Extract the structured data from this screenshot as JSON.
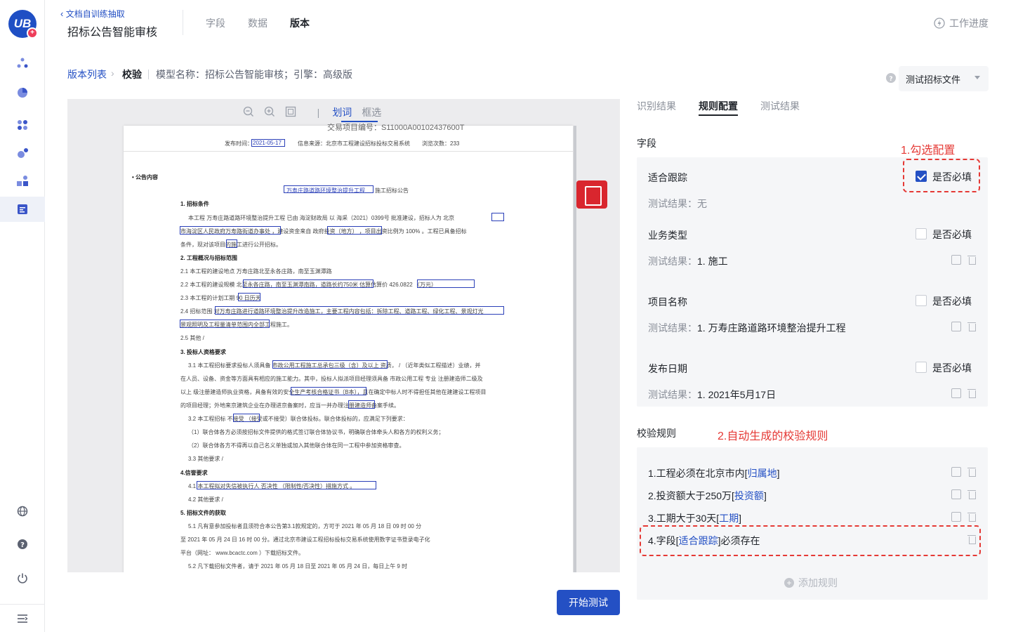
{
  "sidebar": {
    "logo": "UB",
    "logo_plus": "+"
  },
  "header": {
    "back_label": "文档自训练抽取",
    "app_title": "招标公告智能审核",
    "tabs": [
      {
        "label": "字段"
      },
      {
        "label": "数据"
      },
      {
        "label": "版本"
      }
    ],
    "progress_label": "工作进度"
  },
  "breadcrumb": {
    "version_list": "版本列表",
    "separator": "›",
    "current": "校验",
    "model_info": "模型名称：招标公告智能审核；引擎：高级版"
  },
  "file_select": {
    "value": "测试招标文件"
  },
  "viewer": {
    "tool_pipe": "|",
    "tool_word": "划词",
    "tool_box": "框选",
    "doc": {
      "top_cut": "交易项目编号：S11000A00102437600T",
      "meta_time": "发布时间：",
      "meta_date": "2021-05-17",
      "meta_source": "信息来源：北京市工程建设招标投标交易系统",
      "meta_views": "浏览次数：233",
      "section_label": "• 公告内容",
      "doc_title_name": "万寿庄路道路环境整治提升工程",
      "doc_title_suffix": "施工招标公告",
      "h1": "1. 招标条件",
      "p1a": "本工程    万寿庄路道路环境整治提升工程    已由    海淀财政局    以    海采（2021）0399号    批准建设，招标人为    北京",
      "p1b": "市海淀区人民政府万寿路街道办事处    ，建设资金来自    政府投资（地方）    ，项目出资比例为    100%    。工程已具备招标",
      "p1c": "条件，现对该项目的施工进行公开招标。",
      "h2": "2. 工程概况与招标范围",
      "p2a": "2.1  本工程的建设地点    万寿庄路北至永各庄路，南至玉渊潭路",
      "p2b": "2.2  本工程的建设规模    北至永各庄路，南至玉渊潭南路，道路长约750米     估算估算价    426.0822    （万元）",
      "p2c": "2.3  本工程的计划工期    90    日历天",
      "p2d": "2.4  招标范围    对万寿庄路进行道路环境整治提升改造施工，主要工程内容包括：拆除工程、道路工程、绿化工程、景观灯光",
      "p2e": "景观照明及工程量清单范围内全部工程施工。",
      "p2f": "2.5  其他    /",
      "h3": "3. 投标人资格要求",
      "p3a": "3.1 本工程招标要求投标人须具备    市政公用工程施工总承包三级（含）及以上    资质，    /    （近年类似工程描述）业绩，并",
      "p3b": "在人员、设备、资金等方面具有相应的施工能力。其中，投标人拟派项目经理须具备    市政公用工程    专业    注册建造师二级及",
      "p3c": "以上    级注册建造师执业资格，具备有效的安全生产考核合格证书（B本），且在确定中标人时不得担任其他在建建设工程项目",
      "p3d": "的项目经理；外地来京建筑企业在办理进京备案时，应当一并办理注册建造师备案手续。",
      "p3e": "3.2 本工程招标    不接受    （接受或不接受）联合体投标。联合体投标的，应满足下列要求：",
      "p3f": "（1）联合体各方必须按招标文件提供的格式签订联合体协议书，明确联合体牵头人和各方的权利义务；",
      "p3g": "（2）联合体各方不得再以自己名义单独或加入其他联合体在同一工程中参加资格审查。",
      "p3h": "3.3 其他要求    /",
      "h4": "4.信誉要求",
      "p4a": "4.1    本工程拟对失信被执行人    否决性    （限制性/否决性）措施方式    。",
      "p4b": "4.2 其他要求    /",
      "h5": "5. 招标文件的获取",
      "p5a": "5.1 凡有意参加投标者且须符合本公告第3.1款规定的，方可于    2021    年    05    月    18    日    09    时    00    分",
      "p5b": "至    2021    年    05    月    24    日    16    时    00    分。通过北京市建设工程招标投标交易系统使用数字证书登录电子化",
      "p5c": "平台（网址：    www.bcactc.com    ）下载招标文件。",
      "p5d": "5.2 凡下载招标文件者，请于    2021    年    05    月    18    日至    2021    年    05    月    24    日，每日上午    9    时"
    }
  },
  "start_button": "开始测试",
  "right_tabs": [
    {
      "label": "识别结果"
    },
    {
      "label": "规则配置"
    },
    {
      "label": "测试结果"
    }
  ],
  "fields_section": {
    "title": "字段",
    "annotation": "1.勾选配置",
    "test_prefix": "测试结果：",
    "required_label": "是否必填",
    "items": [
      {
        "name": "适合跟踪",
        "result": "无",
        "required": true
      },
      {
        "name": "业务类型",
        "result": "1. 施工",
        "required": false
      },
      {
        "name": "项目名称",
        "result": "1. 万寿庄路道路环境整治提升工程",
        "required": false
      },
      {
        "name": "发布日期",
        "result": "1. 2021年5月17日",
        "required": false
      }
    ]
  },
  "rules_section": {
    "title": "校验规则",
    "annotation": "2.自动生成的校验规则",
    "rules": [
      {
        "prefix": "1.工程必须在北京市内[",
        "field": "归属地",
        "suffix": "]"
      },
      {
        "prefix": "2.投资额大于250万[",
        "field": "投资额",
        "suffix": "]"
      },
      {
        "prefix": "3.工期大于30天[",
        "field": "工期",
        "suffix": "]"
      },
      {
        "prefix": "4.字段[",
        "field": "适合跟踪",
        "suffix": "]必须存在"
      }
    ],
    "add_label": "添加规则",
    "add_icon": "+"
  },
  "colors": {
    "accent": "#2450c4",
    "annotation": "#e53935"
  }
}
